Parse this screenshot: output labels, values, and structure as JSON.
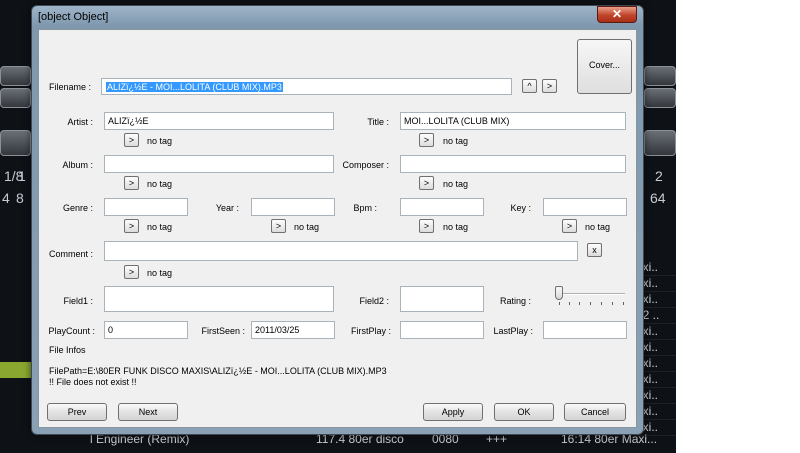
{
  "background": {
    "left_labels": [
      "1/8",
      "1",
      "4",
      "8"
    ],
    "right_labels": [
      "2",
      "64"
    ],
    "list_rows": [
      "axi..",
      "axi..",
      "axi..",
      "12 ..",
      "axi..",
      "axi..",
      "axi..",
      "axi..",
      "axi..",
      "axi..",
      "axi..",
      "axi.."
    ],
    "bottom_row": {
      "title": "l Engineer (Remix)",
      "bpm_genre": "117.4 80er disco",
      "num": "0080",
      "stars": "+++",
      "time_genre": "16:14 80er Maxi..."
    }
  },
  "dialog": {
    "title": {
      "label": "Title :",
      "value": "MOI...LOLITA (CLUB MIX)",
      "btn": ">",
      "tag": "no tag"
    },
    "close_label": "✕",
    "filename": {
      "label": "Filename :",
      "value": "ALIZï¿½E - MOI...LOLITA (CLUB MIX).MP3",
      "up": "^",
      "down": ">"
    },
    "cover_label": "Cover...",
    "artist": {
      "label": "Artist :",
      "value": "ALIZï¿½E",
      "btn": ">",
      "tag": "no tag"
    },
    "album": {
      "label": "Album :",
      "value": "",
      "btn": ">",
      "tag": "no tag"
    },
    "composer": {
      "label": "Composer :",
      "value": "",
      "btn": ">",
      "tag": "no tag"
    },
    "genre": {
      "label": "Genre :",
      "value": "",
      "btn": ">",
      "tag": "no tag"
    },
    "year": {
      "label": "Year :",
      "value": "",
      "btn": ">",
      "tag": "no tag"
    },
    "bpm": {
      "label": "Bpm :",
      "value": "",
      "btn": ">",
      "tag": "no tag"
    },
    "key": {
      "label": "Key :",
      "value": "",
      "btn": ">",
      "tag": "no tag"
    },
    "comment": {
      "label": "Comment :",
      "value": "",
      "btn": ">",
      "tag": "no tag",
      "clear": "x"
    },
    "field1": {
      "label": "Field1 :",
      "value": ""
    },
    "field2": {
      "label": "Field2 :",
      "value": ""
    },
    "rating": {
      "label": "Rating :",
      "value": 0
    },
    "playcount": {
      "label": "PlayCount :",
      "value": "0"
    },
    "firstseen": {
      "label": "FirstSeen :",
      "value": "2011/03/25"
    },
    "firstplay": {
      "label": "FirstPlay :",
      "value": ""
    },
    "lastplay": {
      "label": "LastPlay :",
      "value": ""
    },
    "file_infos": {
      "label": "File Infos",
      "path": "FilePath=E:\\80ER FUNK DISCO MAXIS\\ALIZï¿½E - MOI...LOLITA (CLUB MIX).MP3",
      "status": "!! File does not exist !!"
    },
    "buttons": {
      "prev": "Prev",
      "next": "Next",
      "apply": "Apply",
      "ok": "OK",
      "cancel": "Cancel"
    }
  }
}
